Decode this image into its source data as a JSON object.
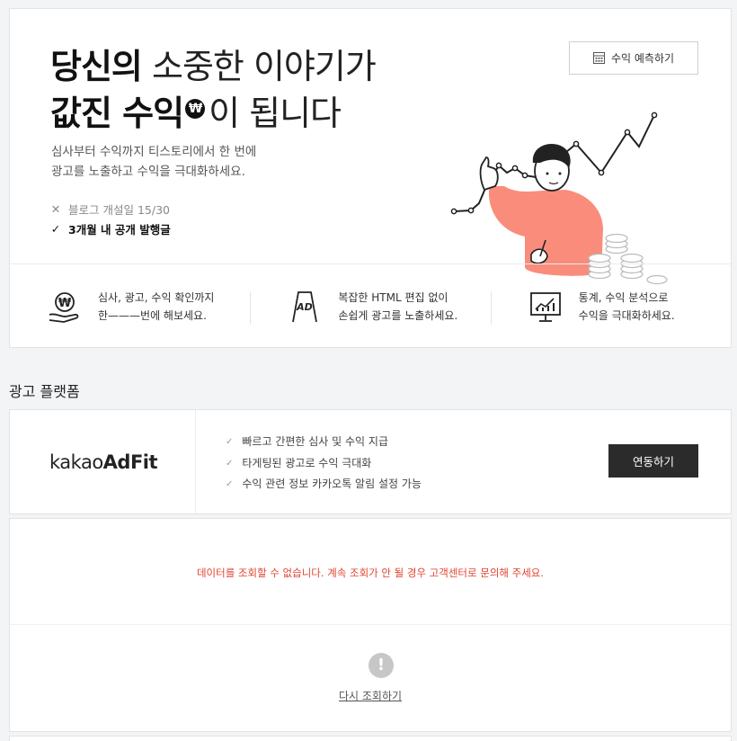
{
  "hero": {
    "title_line1_bold": "당신의",
    "title_line1_light": "소중한 이야기가",
    "title_line2_bold": "값진 수익",
    "won_symbol": "₩",
    "title_line2_light": "이 됩니다",
    "desc_line1": "심사부터 수익까지 티스토리에서 한 번에",
    "desc_line2": "광고를 노출하고 수익을 극대화하세요.",
    "conditions": [
      {
        "mark": "✕",
        "text": "블로그 개설일 15/30"
      },
      {
        "mark": "✓",
        "text": "3개월 내 공개 발행글"
      }
    ],
    "forecast_button": "수익 예측하기",
    "forecast_icon": "calculator-icon"
  },
  "features": [
    {
      "icon": "hand-coin-icon",
      "line1": "심사, 광고, 수익 확인까지",
      "line2": "한———번에 해보세요."
    },
    {
      "icon": "ad-board-icon",
      "line1": "복잡한 HTML 편집 없이",
      "line2": "손쉽게 광고를 노출하세요."
    },
    {
      "icon": "monitor-chart-icon",
      "line1": "통계, 수익 분석으로",
      "line2": "수익을 극대화하세요."
    }
  ],
  "section_title": "광고 플랫폼",
  "adfit": {
    "logo_light": "kakao",
    "logo_bold": "AdFit",
    "benefits": [
      "빠르고 간편한 심사 및 수익 지급",
      "타게팅된 광고로 수익 극대화",
      "수익 관련 정보 카카오톡 알림 설정 가능"
    ],
    "connect_button": "연동하기"
  },
  "error": {
    "message": "데이터를 조회할 수 없습니다. 계속 조회가 안 될 경우 고객센터로 문의해 주세요.",
    "icon": "!",
    "retry": "다시 조회하기"
  },
  "colors": {
    "error": "#e0432f",
    "accent_illus": "#fa8c7c",
    "dark_button": "#2b2b2b"
  }
}
